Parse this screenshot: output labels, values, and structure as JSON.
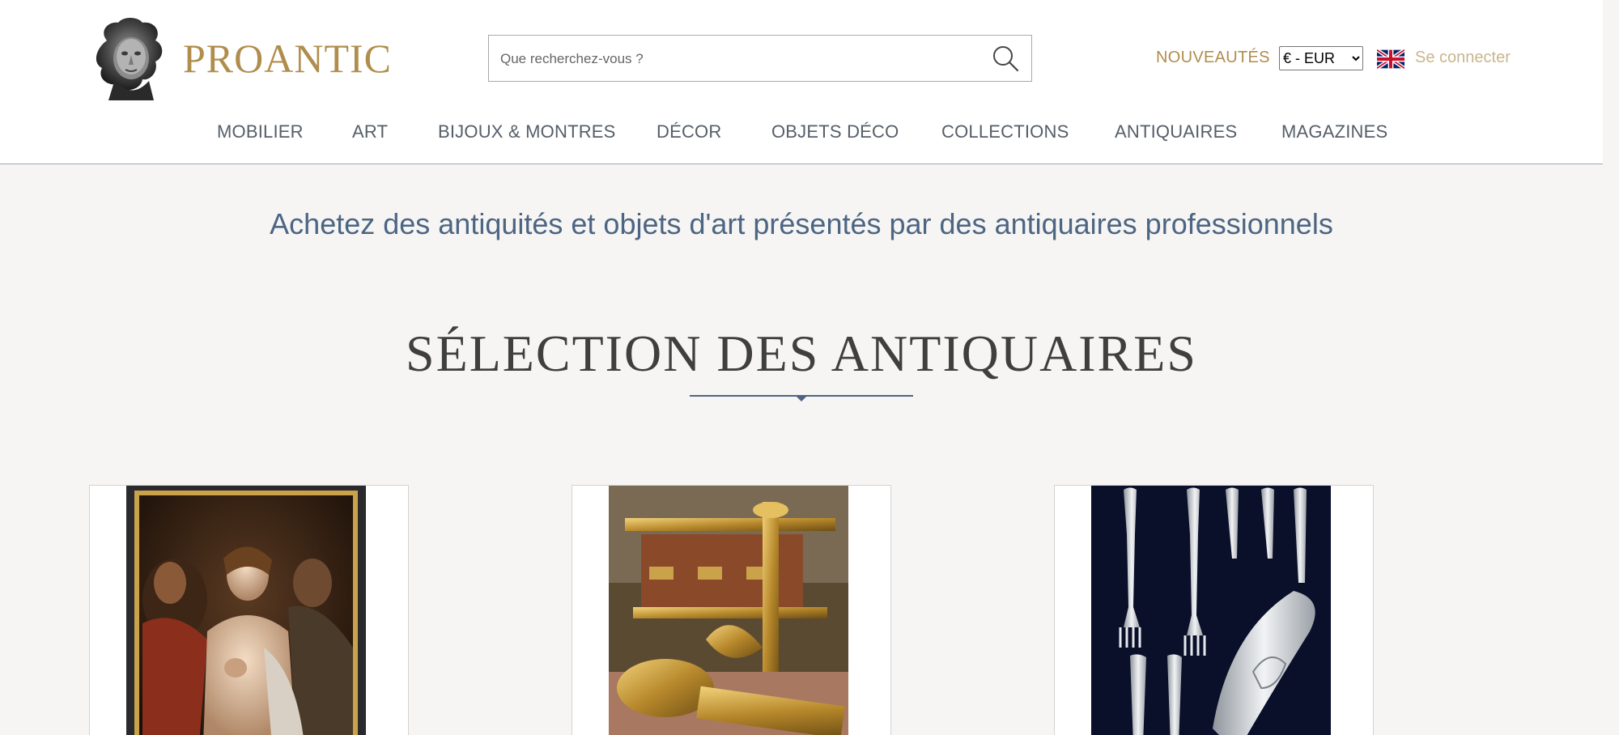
{
  "header": {
    "logo_text": "PROANTIC",
    "search_placeholder": "Que recherchez-vous ?",
    "nouveautes_label": "NOUVEAUTÉS",
    "currency_selected": "€ - EUR",
    "login_label": "Se connecter"
  },
  "nav": {
    "items": [
      {
        "label": "MOBILIER"
      },
      {
        "label": "ART"
      },
      {
        "label": "BIJOUX & MONTRES"
      },
      {
        "label": "DÉCOR"
      },
      {
        "label": "OBJETS DÉCO"
      },
      {
        "label": "COLLECTIONS"
      },
      {
        "label": "ANTIQUAIRES"
      },
      {
        "label": "MAGAZINES"
      }
    ]
  },
  "main": {
    "tagline": "Achetez des antiquités et objets d'art présentés par des antiquaires professionnels",
    "section_title": "SÉLECTION DES ANTIQUAIRES"
  },
  "colors": {
    "brand_gold": "#b08d4c",
    "tagline_blue": "#4c6583",
    "page_bg": "#f6f5f3"
  }
}
